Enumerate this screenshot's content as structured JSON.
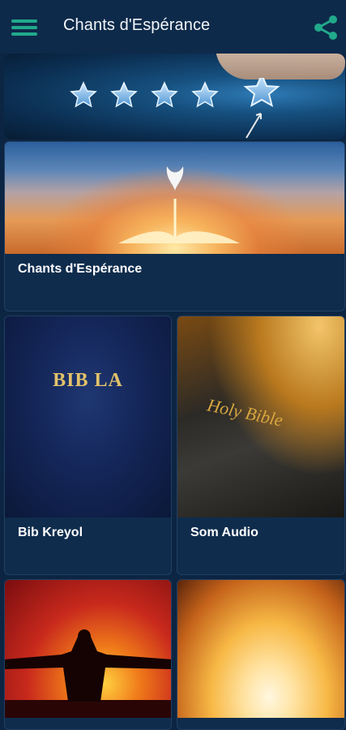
{
  "appbar": {
    "title": "Chants d'Espérance",
    "menu_icon": "hamburger-menu-icon",
    "share_icon": "share-icon",
    "accent_color": "#21a98b"
  },
  "rating_banner": {
    "star_count": 5,
    "star_icon": "star-icon"
  },
  "cards": {
    "chants": {
      "label": "Chants d'Espérance"
    },
    "bib_kreyol": {
      "label": "Bib Kreyol",
      "cover_text": "BIB LA"
    },
    "som_audio": {
      "label": "Som Audio",
      "cover_text": "Holy Bible"
    }
  },
  "colors": {
    "background": "#0c2542",
    "card": "#0f2c4d",
    "text": "#ffffff"
  }
}
